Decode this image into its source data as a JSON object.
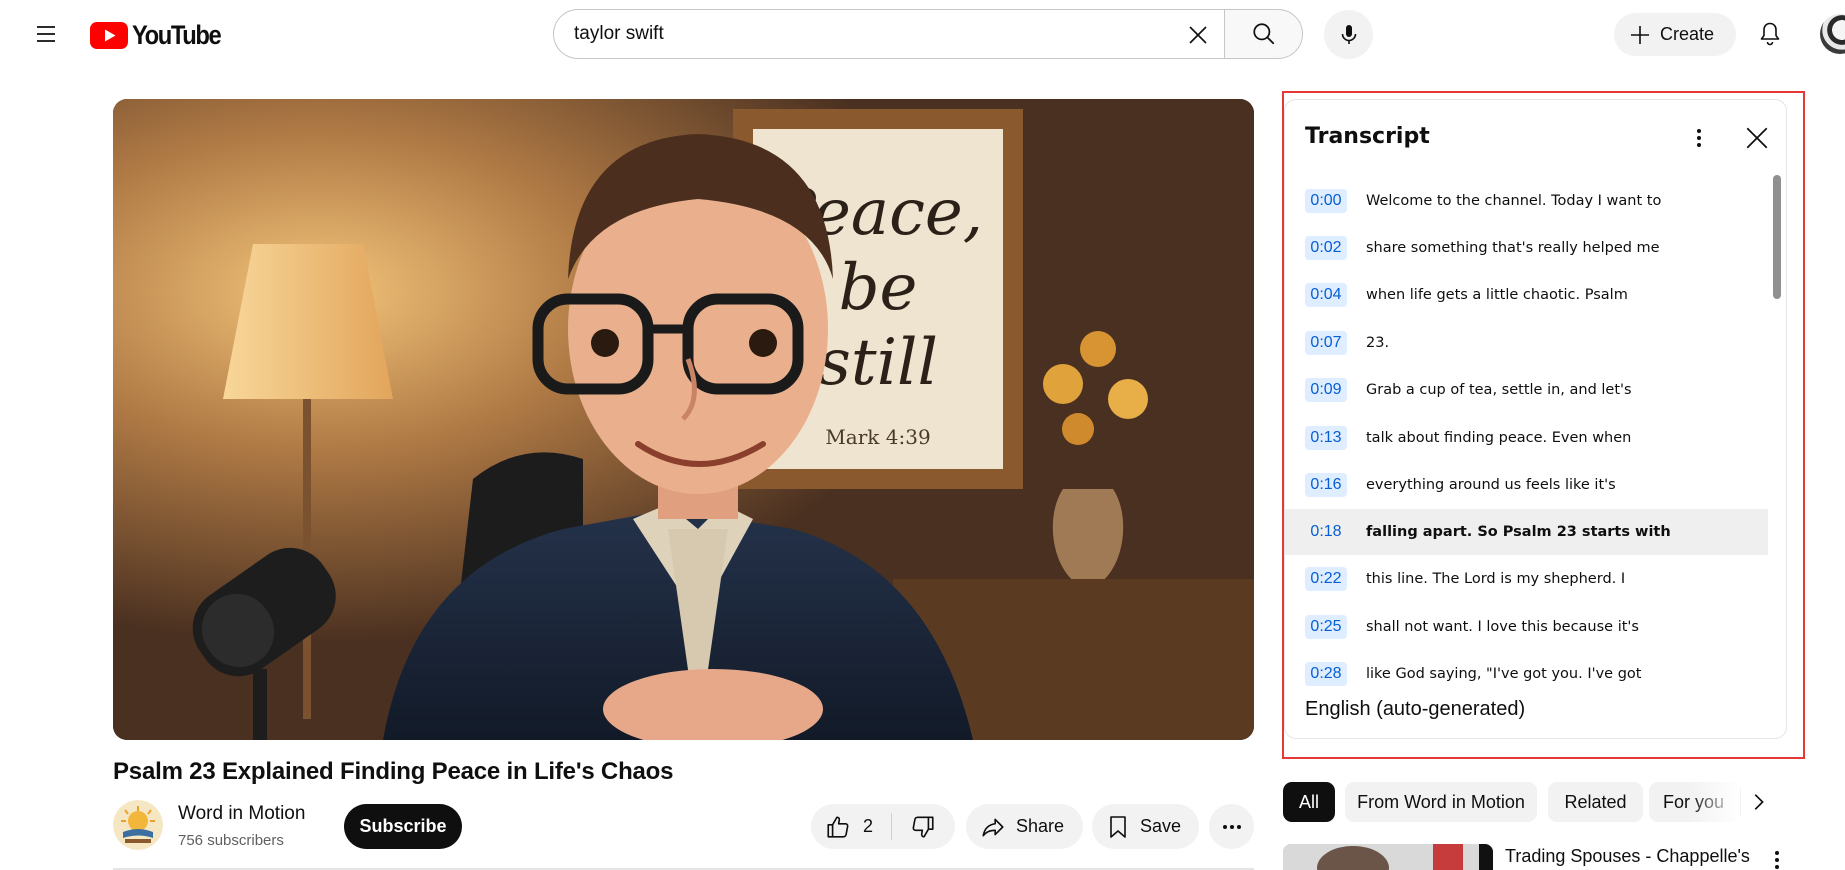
{
  "header": {
    "logo_text": "YouTube",
    "search_value": "taylor swift",
    "create_label": "Create"
  },
  "video": {
    "title": "Psalm 23 Explained Finding Peace in Life's Chaos",
    "poster_lines": [
      "Peace,",
      "be",
      "still"
    ],
    "poster_reference": "Mark 4:39",
    "channel_name": "Word in Motion",
    "subscribers": "756 subscribers",
    "subscribe_label": "Subscribe",
    "like_count": "2",
    "share_label": "Share",
    "save_label": "Save"
  },
  "transcript": {
    "title": "Transcript",
    "language": "English (auto-generated)",
    "active_index": 7,
    "segments": [
      {
        "time": "0:00",
        "text": "Welcome to the channel. Today I want to"
      },
      {
        "time": "0:02",
        "text": "share something that's really helped me"
      },
      {
        "time": "0:04",
        "text": "when life gets a little chaotic. Psalm"
      },
      {
        "time": "0:07",
        "text": "23."
      },
      {
        "time": "0:09",
        "text": "Grab a cup of tea, settle in, and let's"
      },
      {
        "time": "0:13",
        "text": "talk about finding peace. Even when"
      },
      {
        "time": "0:16",
        "text": "everything around us feels like it's"
      },
      {
        "time": "0:18",
        "text": "falling apart. So Psalm 23 starts with"
      },
      {
        "time": "0:22",
        "text": "this line. The Lord is my shepherd. I"
      },
      {
        "time": "0:25",
        "text": "shall not want. I love this because it's"
      },
      {
        "time": "0:28",
        "text": "like God saying, \"I've got you. I've got"
      }
    ]
  },
  "chips": [
    {
      "label": "All",
      "selected": true
    },
    {
      "label": "From Word in Motion",
      "selected": false
    },
    {
      "label": "Related",
      "selected": false
    },
    {
      "label": "For you",
      "selected": false
    }
  ],
  "recommendation": {
    "title": "Trading Spouses - Chappelle's"
  },
  "colors": {
    "youtube_red": "#ff0000",
    "timestamp_blue": "#065fd4",
    "timestamp_bg": "#deedff",
    "highlight_frame": "#e53935"
  },
  "icons": {
    "menu": "hamburger-menu-icon",
    "clear": "close-icon",
    "search": "search-icon",
    "mic": "microphone-icon",
    "create": "plus-icon",
    "notifications": "bell-icon",
    "like": "thumbs-up-icon",
    "dislike": "thumbs-down-icon",
    "share": "share-arrow-icon",
    "save": "bookmark-icon",
    "more": "more-horizontal-icon",
    "transcript_more": "more-vertical-icon",
    "transcript_close": "close-icon",
    "chips_next": "chevron-right-icon"
  }
}
